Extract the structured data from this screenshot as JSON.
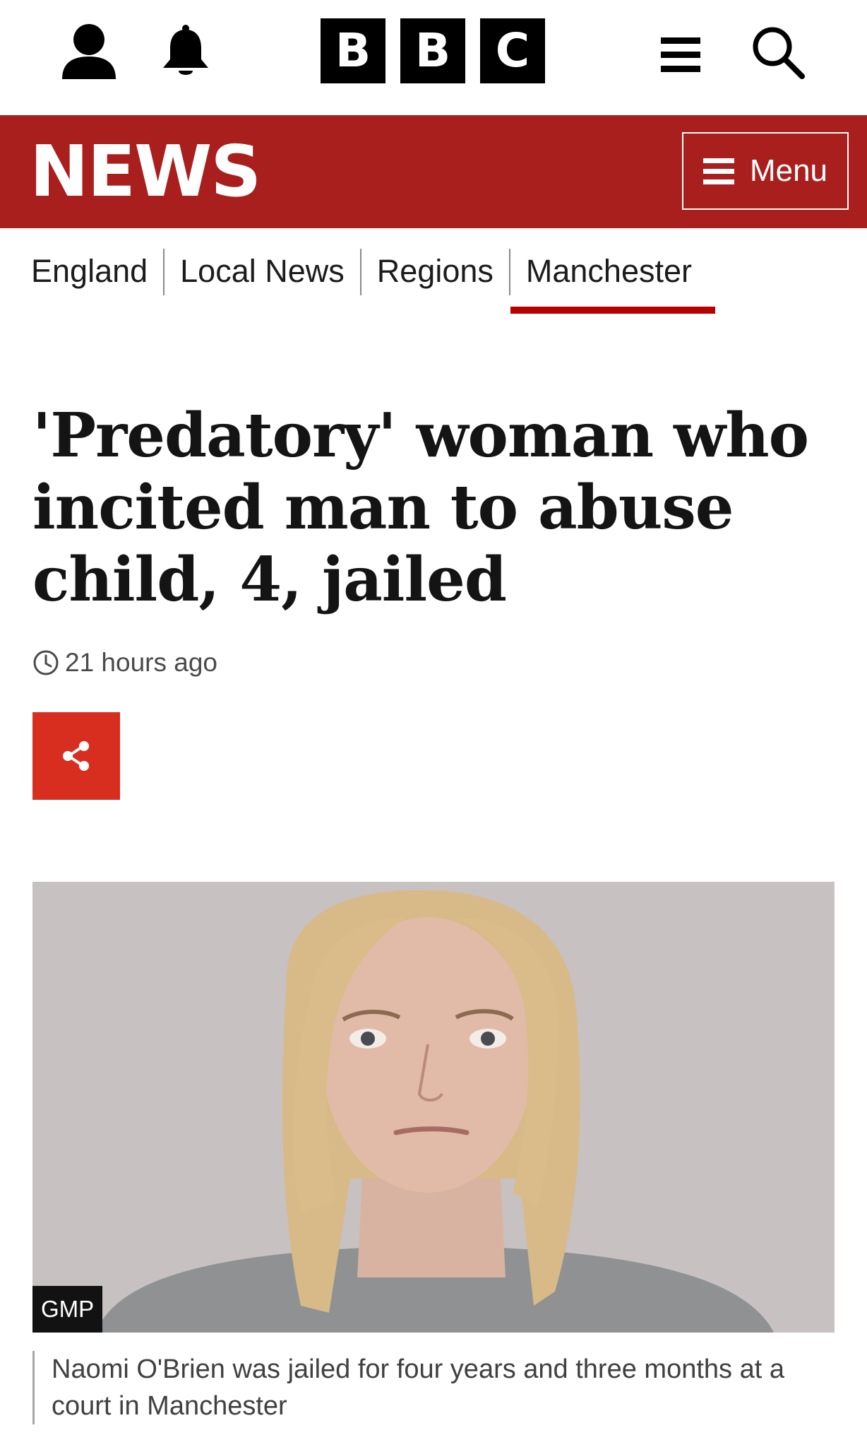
{
  "header": {
    "account_icon": "user-account-icon",
    "notifications_icon": "bell-icon",
    "logo_letters": [
      "B",
      "B",
      "C"
    ],
    "site_menu_icon": "hamburger-icon",
    "search_icon": "search-icon"
  },
  "news_banner": {
    "wordmark": "NEWS",
    "menu_label": "Menu",
    "menu_icon": "hamburger-icon",
    "background_color": "#a91f1d"
  },
  "section_nav": {
    "items": [
      {
        "label": "England"
      },
      {
        "label": "Local News"
      },
      {
        "label": "Regions"
      },
      {
        "label": "Manchester",
        "active": true
      }
    ],
    "active_color": "#b80000"
  },
  "article": {
    "headline": "'Predatory' woman who incited man to abuse child, 4, jailed",
    "timestamp": "21 hours ago",
    "timestamp_icon": "clock-icon",
    "share_icon": "share-icon",
    "share_color": "#d82e20",
    "image": {
      "credit": "GMP",
      "caption": "Naomi O'Brien was jailed for four years and three months at a court in Manchester"
    }
  }
}
